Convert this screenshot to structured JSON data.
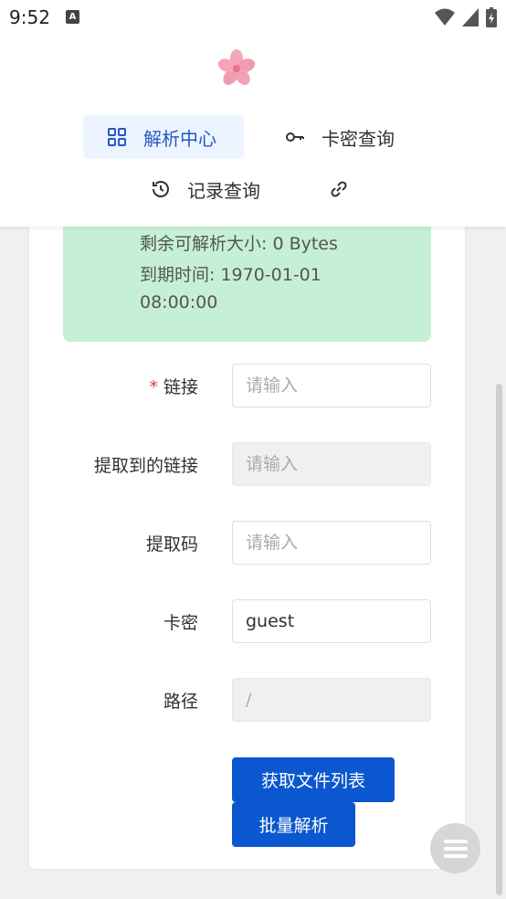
{
  "status_bar": {
    "time": "9:52",
    "notification_glyph": "A"
  },
  "nav": {
    "parse_center": "解析中心",
    "card_query": "卡密查询",
    "record_query": "记录查询"
  },
  "info": {
    "remaining": "剩余可解析大小: 0 Bytes",
    "expire_line1": "到期时间: 1970-01-01",
    "expire_line2": "08:00:00"
  },
  "form": {
    "link": {
      "required_mark": "*",
      "label": "链接",
      "placeholder": "请输入"
    },
    "extracted_link": {
      "label": "提取到的链接",
      "placeholder": "请输入"
    },
    "extract_code": {
      "label": "提取码",
      "placeholder": "请输入"
    },
    "card_key": {
      "label": "卡密",
      "value": "guest"
    },
    "path": {
      "label": "路径",
      "value": "/"
    }
  },
  "buttons": {
    "get_file_list": "获取文件列表",
    "batch_parse": "批量解析"
  },
  "colors": {
    "primary": "#0b57d0",
    "info_bg": "#c6f0d6",
    "nav_active_bg": "#ecf5ff"
  }
}
